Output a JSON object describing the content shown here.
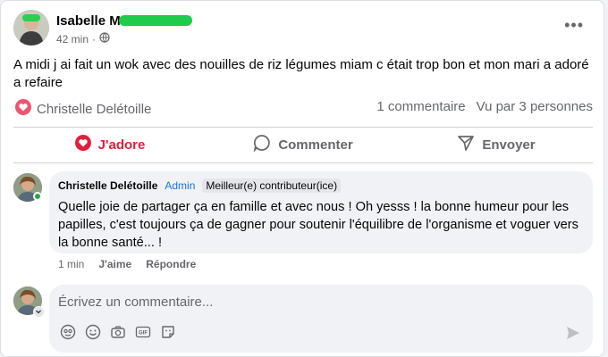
{
  "post": {
    "author_visible": "Isabelle M",
    "time": "42 min",
    "audience_icon": "globe-icon",
    "more_icon": "more-dots-icon",
    "text": "A midi j ai fait un wok avec des nouilles de riz légumes miam c était trop bon et mon mari a adoré a refaire"
  },
  "reactions": {
    "reactor": "Christelle Delétoille",
    "comments_count": "1 commentaire",
    "seen_by": "Vu par 3 personnes",
    "heart_color": "#e41e3f"
  },
  "actions": {
    "love_label": "J'adore",
    "comment_label": "Commenter",
    "send_label": "Envoyer"
  },
  "comment": {
    "author": "Christelle Delétoille",
    "role": "Admin",
    "badge": "Meilleur(e) contributeur(ice)",
    "text": "Quelle joie de partager ça en famille et avec nous ! Oh yesss ! la bonne humeur pour les papilles, c'est toujours ça de gagner pour soutenir l'équilibre de l'organisme et voguer vers la bonne santé... !",
    "time": "1 min",
    "like_label": "J'aime",
    "reply_label": "Répondre"
  },
  "composer": {
    "placeholder": "Écrivez un commentaire..."
  },
  "colors": {
    "accent_blue": "#1b74e4",
    "love_red": "#e41e3f",
    "muted": "#65676b",
    "online_green": "#31a24c"
  }
}
